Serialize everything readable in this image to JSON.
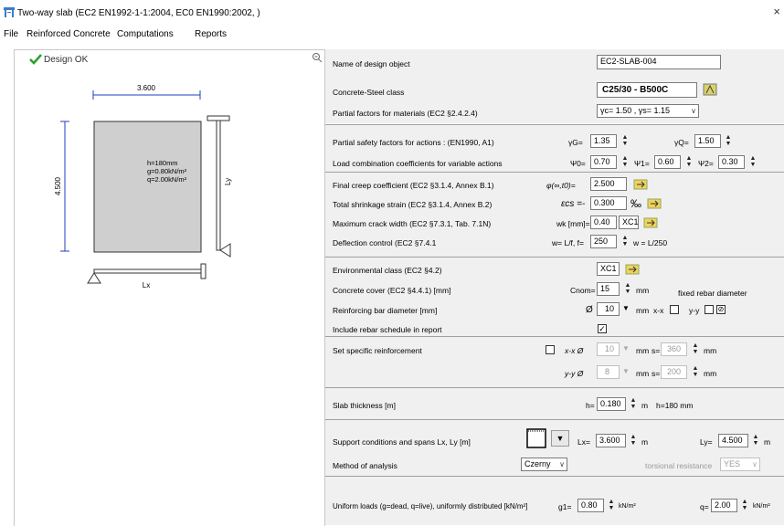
{
  "window": {
    "title": "Two-way slab (EC2 EN1992-1-1:2004, EC0 EN1990:2002, )",
    "close": "×"
  },
  "menu": [
    "File",
    "Reinforced Concrete",
    "Computations",
    "Reports"
  ],
  "left": {
    "status": "Design OK",
    "drawing": {
      "lx_dim": "3.600",
      "ly_dim": "4.500",
      "ly_label": "Ly",
      "lx_label": "Lx",
      "slab_info": [
        "h=180mm",
        "g=0.80kN/m²",
        "q=2.00kN/m²"
      ]
    }
  },
  "form": {
    "name_label": "Name of design object",
    "name_value": "EC2-SLAB-004",
    "concrete_label": "Concrete-Steel class",
    "concrete_value": "C25/30 - B500C",
    "partial_mat_label": "Partial factors for materials (EC2 §2.4.2.4)",
    "partial_mat_value": "γc= 1.50 , γs= 1.15",
    "partial_act_label": "Partial safety factors for actions : (EN1990, A1)",
    "gG_label": "γG=",
    "gG_value": "1.35",
    "gQ_label": "γQ=",
    "gQ_value": "1.50",
    "loadcomb_label": "Load combination coefficients for variable actions",
    "psi0_label": "Ψ0=",
    "psi0_value": "0.70",
    "psi1_label": "Ψ1=",
    "psi1_value": "0.60",
    "psi2_label": "Ψ2=",
    "psi2_value": "0.30",
    "creep_label": "Final creep coefficient (EC2 §3.1.4, Annex B.1)",
    "creep_sym": "φ(∞,t0)=",
    "creep_value": "2.500",
    "shrink_label": "Total shrinkage strain (EC2 §3.1.4, Annex B.2)",
    "shrink_sym": "εcs =-",
    "shrink_value": "0.300",
    "shrink_unit": "‰",
    "crack_label": "Maximum crack width (EC2 §7.3.1, Tab. 7.1N)",
    "crack_sym": "wk [mm]=",
    "crack_value": "0.40",
    "crack_class": "XC1",
    "defl_label": "Deflection control (EC2 §7.4.1",
    "defl_sym": "w= L/f, f=",
    "defl_value": "250",
    "defl_result": "w = L/250",
    "env_label": "Environmental class (EC2 §4.2)",
    "env_value": "XC1",
    "cover_label": "Concrete cover (EC2 §4.4.1) [mm]",
    "cover_sym": "Cnom=",
    "cover_value": "15",
    "cover_unit": "mm",
    "fixed_dia_label": "fixed rebar diameter",
    "bar_label": "Reinforcing bar diameter [mm]",
    "bar_sym": "Ø",
    "bar_value": "10",
    "bar_unit": "mm",
    "xx_label": "x-x",
    "yy_label": "y-y",
    "dia_icon": "⊘",
    "schedule_label": "Include rebar schedule in report",
    "specific_label": "Set specific reinforcement",
    "sp_xx": "x-x Ø",
    "sp_x_dia": "10",
    "sp_x_mm": "mm",
    "sp_x_s_label": "s=",
    "sp_x_s": "360",
    "sp_x_s_unit": "mm",
    "sp_yy": "y-y Ø",
    "sp_y_dia": "8",
    "sp_y_mm": "mm",
    "sp_y_s_label": "s=",
    "sp_y_s": "200",
    "sp_y_s_unit": "mm",
    "thick_label": "Slab thickness [m]",
    "thick_sym": "h=",
    "thick_value": "0.180",
    "thick_unit": "m",
    "thick_result": "h=180 mm",
    "support_label": "Support conditions and spans Lx, Ly [m]",
    "lx_sym": "Lx=",
    "lx_value": "3.600",
    "lx_unit": "m",
    "ly_sym": "Ly=",
    "ly_value": "4.500",
    "ly_unit": "m",
    "method_label": "Method of analysis",
    "method_value": "Czerny",
    "torsional_label": "torsional resistance",
    "torsional_value": "YES",
    "loads_label": "Uniform loads (g=dead, q=live), uniformly distributed  [kN/m²]",
    "g1_sym": "g1=",
    "g1_value": "0.80",
    "g1_unit": "kN/m²",
    "q_sym": "q=",
    "q_value": "2.00",
    "q_unit": "kN/m²"
  }
}
